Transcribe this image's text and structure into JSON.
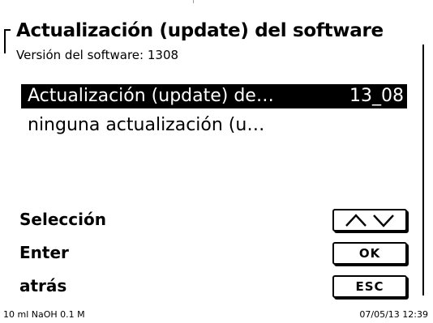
{
  "header": {
    "title": "Actualización (update) del software",
    "version": "Versión del software: 1308"
  },
  "list": {
    "items": [
      {
        "label": "Actualización (update) de…",
        "value": "13_08",
        "selected": true
      },
      {
        "label": "ninguna  actualización (u…",
        "value": "",
        "selected": false
      }
    ]
  },
  "actions": [
    {
      "label": "Selección",
      "key": "up-down-arrows",
      "key_icon": "up-down-arrows-icon"
    },
    {
      "label": "Enter",
      "key": "OK"
    },
    {
      "label": "atrás",
      "key": "ESC"
    }
  ],
  "status": {
    "left": "10 ml NaOH 0.1 M",
    "right": "07/05/13 12:39"
  },
  "colors": {
    "background": "#ffffff",
    "foreground": "#000000",
    "selection_background": "#000000",
    "selection_text": "#ffffff"
  }
}
